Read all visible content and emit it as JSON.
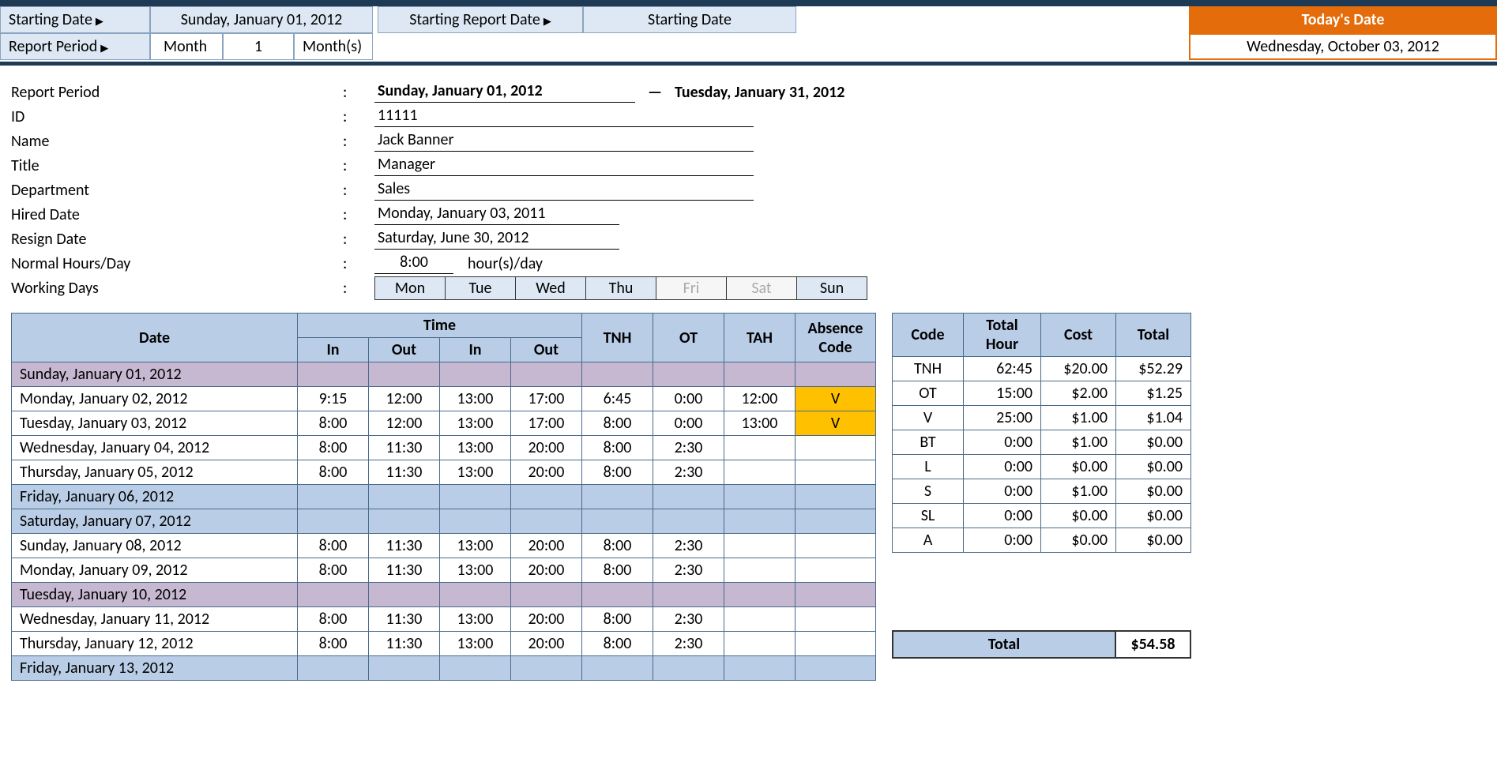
{
  "header": {
    "starting_date_label": "Starting Date",
    "starting_date_value": "Sunday, January 01, 2012",
    "report_period_label": "Report Period",
    "rp_unit": "Month",
    "rp_count": "1",
    "rp_unit_plural": "Month(s)",
    "starting_report_date_label": "Starting Report Date",
    "starting_report_value": "Starting Date",
    "today_label": "Today's Date",
    "today_value": "Wednesday, October 03, 2012"
  },
  "info": {
    "labels": {
      "report_period": "Report Period",
      "id": "ID",
      "name": "Name",
      "title": "Title",
      "department": "Department",
      "hired_date": "Hired Date",
      "resign_date": "Resign Date",
      "normal_hours": "Normal Hours/Day",
      "working_days": "Working Days"
    },
    "report_start": "Sunday, January 01, 2012",
    "report_end": "Tuesday, January 31, 2012",
    "id": "11111",
    "name": "Jack Banner",
    "title": "Manager",
    "department": "Sales",
    "hired_date": "Monday, January 03, 2011",
    "resign_date": "Saturday, June 30, 2012",
    "normal_hours_value": "8:00",
    "normal_hours_unit": "hour(s)/day",
    "days": [
      "Mon",
      "Tue",
      "Wed",
      "Thu",
      "Fri",
      "Sat",
      "Sun"
    ],
    "days_dim": [
      false,
      false,
      false,
      false,
      true,
      true,
      false
    ]
  },
  "table": {
    "headers": {
      "date": "Date",
      "time": "Time",
      "in": "In",
      "out": "Out",
      "tnh": "TNH",
      "ot": "OT",
      "tah": "TAH",
      "abs": "Absence Code"
    },
    "rows": [
      {
        "date": "Sunday, January 01, 2012",
        "kind": "purple"
      },
      {
        "date": "Monday, January 02, 2012",
        "in1": "9:15",
        "out1": "12:00",
        "in2": "13:00",
        "out2": "17:00",
        "tnh": "6:45",
        "ot": "0:00",
        "tah": "12:00",
        "abs": "V"
      },
      {
        "date": "Tuesday, January 03, 2012",
        "in1": "8:00",
        "out1": "12:00",
        "in2": "13:00",
        "out2": "17:00",
        "tnh": "8:00",
        "ot": "0:00",
        "tah": "13:00",
        "abs": "V"
      },
      {
        "date": "Wednesday, January 04, 2012",
        "in1": "8:00",
        "out1": "11:30",
        "in2": "13:00",
        "out2": "20:00",
        "tnh": "8:00",
        "ot": "2:30"
      },
      {
        "date": "Thursday, January 05, 2012",
        "in1": "8:00",
        "out1": "11:30",
        "in2": "13:00",
        "out2": "20:00",
        "tnh": "8:00",
        "ot": "2:30"
      },
      {
        "date": "Friday, January 06, 2012",
        "kind": "blue"
      },
      {
        "date": "Saturday, January 07, 2012",
        "kind": "blue"
      },
      {
        "date": "Sunday, January 08, 2012",
        "in1": "8:00",
        "out1": "11:30",
        "in2": "13:00",
        "out2": "20:00",
        "tnh": "8:00",
        "ot": "2:30"
      },
      {
        "date": "Monday, January 09, 2012",
        "in1": "8:00",
        "out1": "11:30",
        "in2": "13:00",
        "out2": "20:00",
        "tnh": "8:00",
        "ot": "2:30"
      },
      {
        "date": "Tuesday, January 10, 2012",
        "kind": "purple"
      },
      {
        "date": "Wednesday, January 11, 2012",
        "in1": "8:00",
        "out1": "11:30",
        "in2": "13:00",
        "out2": "20:00",
        "tnh": "8:00",
        "ot": "2:30"
      },
      {
        "date": "Thursday, January 12, 2012",
        "in1": "8:00",
        "out1": "11:30",
        "in2": "13:00",
        "out2": "20:00",
        "tnh": "8:00",
        "ot": "2:30"
      },
      {
        "date": "Friday, January 13, 2012",
        "kind": "blue"
      }
    ]
  },
  "summary": {
    "headers": {
      "code": "Code",
      "hour": "Total Hour",
      "cost": "Cost",
      "total": "Total"
    },
    "rows": [
      {
        "code": "TNH",
        "hour": "62:45",
        "cost": "$20.00",
        "total": "$52.29"
      },
      {
        "code": "OT",
        "hour": "15:00",
        "cost": "$2.00",
        "total": "$1.25"
      },
      {
        "code": "V",
        "hour": "25:00",
        "cost": "$1.00",
        "total": "$1.04"
      },
      {
        "code": "BT",
        "hour": "0:00",
        "cost": "$1.00",
        "total": "$0.00"
      },
      {
        "code": "L",
        "hour": "0:00",
        "cost": "$0.00",
        "total": "$0.00"
      },
      {
        "code": "S",
        "hour": "0:00",
        "cost": "$1.00",
        "total": "$0.00"
      },
      {
        "code": "SL",
        "hour": "0:00",
        "cost": "$0.00",
        "total": "$0.00"
      },
      {
        "code": "A",
        "hour": "0:00",
        "cost": "$0.00",
        "total": "$0.00"
      }
    ],
    "grand_label": "Total",
    "grand_value": "$54.58"
  }
}
